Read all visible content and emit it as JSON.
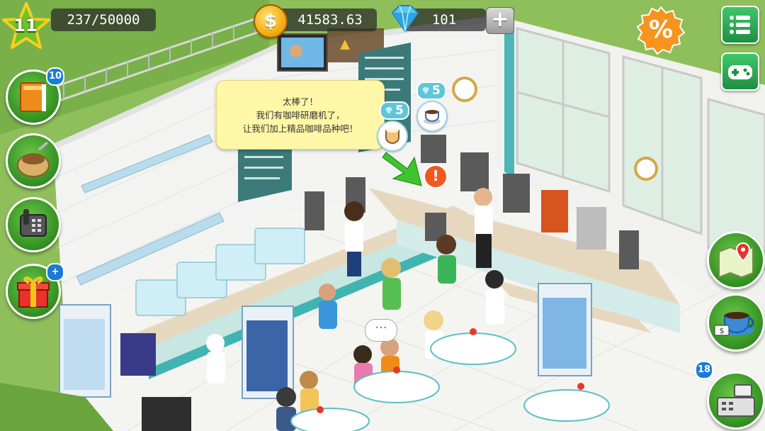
{
  "hud": {
    "level": "11",
    "xp": "237/50000",
    "coins": "41583.63",
    "gems": "101",
    "add_label": "+",
    "sale_label": "%"
  },
  "side_buttons": [
    {
      "name": "recipe-book",
      "badge": "10"
    },
    {
      "name": "coffee-ingredients",
      "badge": ""
    },
    {
      "name": "phone-orders",
      "badge": ""
    },
    {
      "name": "gift-box",
      "badge": "+"
    }
  ],
  "right_buttons": [
    {
      "name": "city-map",
      "badge": ""
    },
    {
      "name": "coffee-cup-sell",
      "badge": ""
    },
    {
      "name": "cash-register",
      "badge": "18"
    }
  ],
  "dialog": {
    "lines": [
      "太棒了！",
      "我们有咖啡研磨机了，",
      "让我们加上精品咖啡品种吧！"
    ]
  },
  "order_tags": [
    {
      "gems": "5"
    },
    {
      "gems": "5"
    }
  ],
  "alert": "!",
  "chat": "···",
  "colors": {
    "accent_green": "#2e8a1d",
    "bubble_yellow": "#fff7a8",
    "coin_gold": "#f2a600",
    "gem_blue": "#5fc6d8",
    "floor": "#f4f4f0"
  }
}
